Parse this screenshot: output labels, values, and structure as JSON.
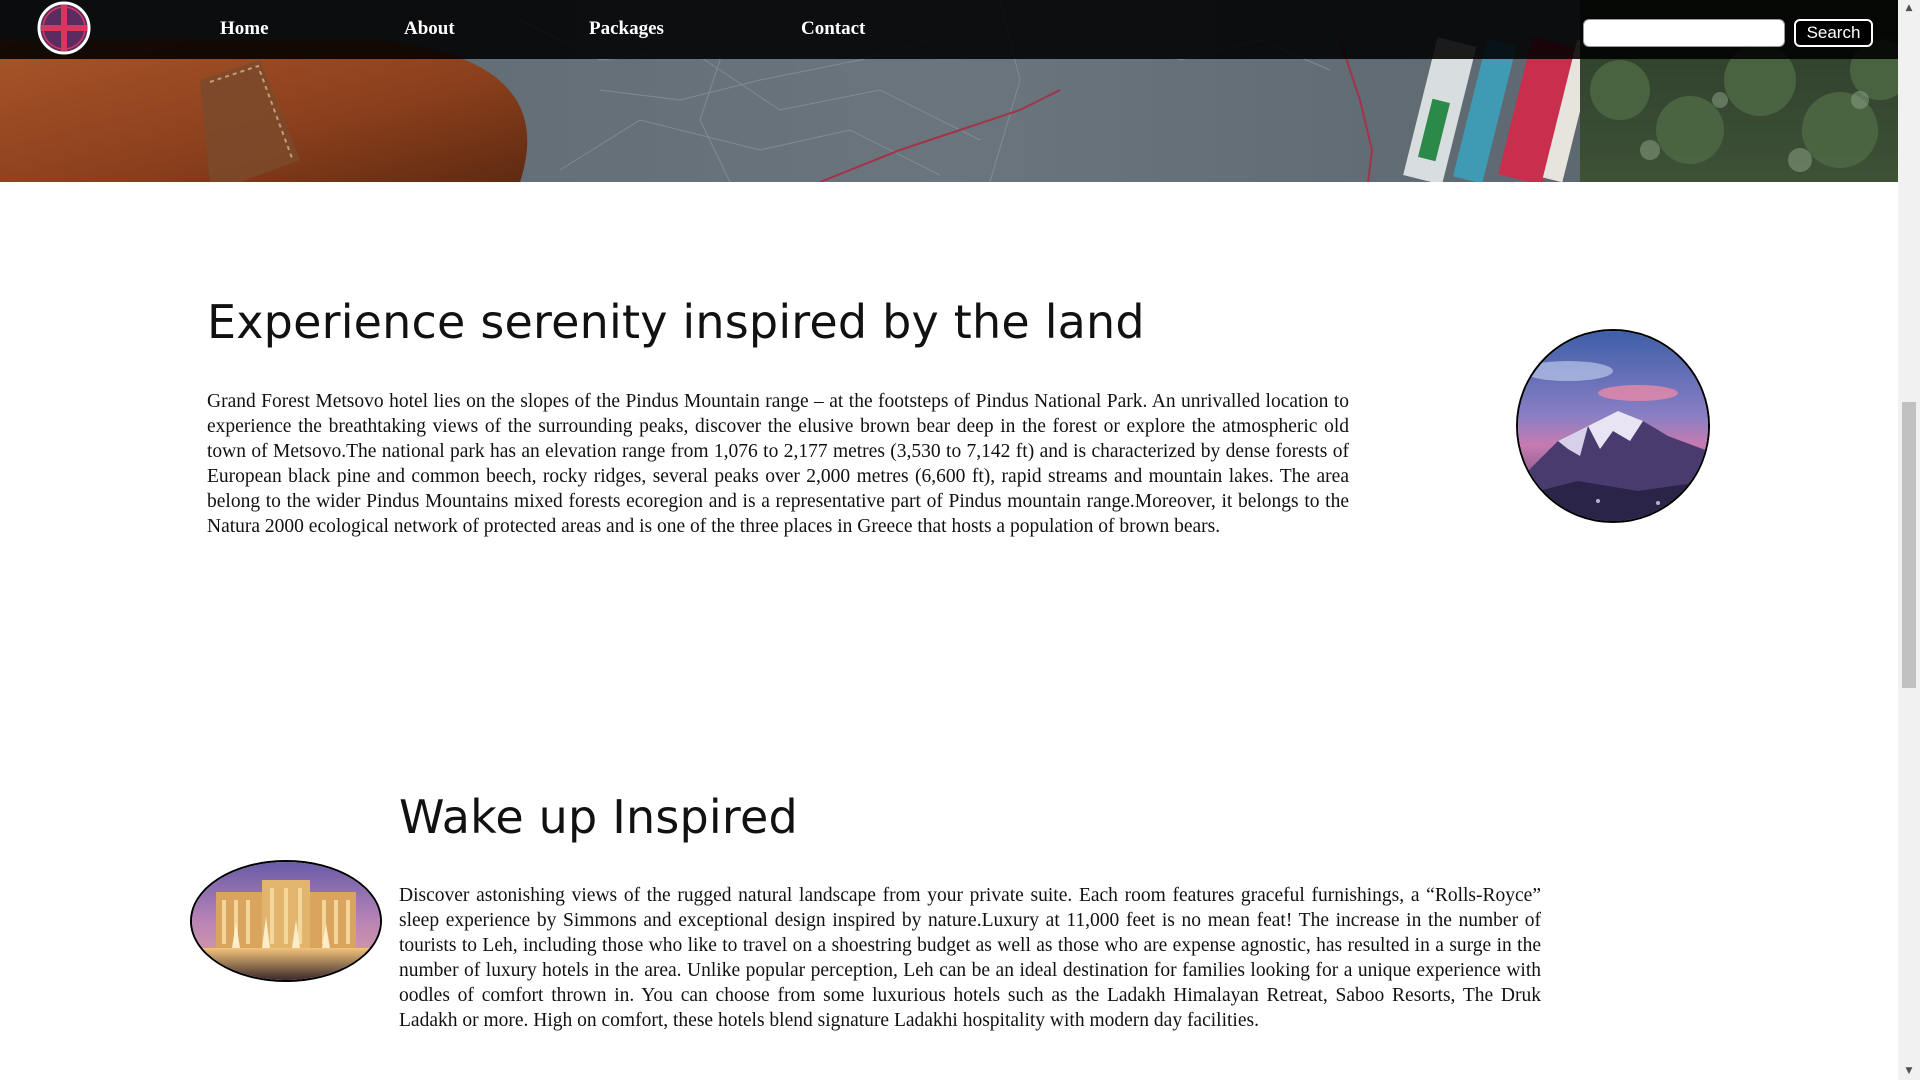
{
  "nav": {
    "logo_icon": "globe-cross-logo-icon",
    "links": [
      {
        "label": "Home"
      },
      {
        "label": "About"
      },
      {
        "label": "Packages"
      },
      {
        "label": "Contact"
      }
    ],
    "search": {
      "value": "",
      "placeholder": "",
      "button_label": "Search"
    }
  },
  "hero": {
    "image": "travel-map-bag-banner"
  },
  "section1": {
    "heading": "Experience serenity inspired by the land",
    "paragraph": "Grand Forest Metsovo hotel lies on the slopes of the Pindus Mountain range – at the footsteps of Pindus National Park. An unrivalled location to experience the breathtaking views of the surrounding peaks, discover the elusive brown bear deep in the forest or explore the atmospheric old town of Metsovo.The national park has an elevation range from 1,076 to 2,177 metres (3,530 to 7,142 ft) and is characterized by dense forests of European black pine and common beech, rocky ridges, several peaks over 2,000 metres (6,600 ft), rapid streams and mountain lakes. The area belong to the wider Pindus Mountains mixed forests ecoregion and is a representative part of Pindus mountain range.Moreover, it belongs to the Natura 2000 ecological network of protected areas and is one of the three places in Greece that hosts a population of brown bears.",
    "image": "snowy-mountain-sunset-photo"
  },
  "section2": {
    "heading": "Wake up Inspired",
    "paragraph": "Discover astonishing views of the rugged natural landscape from your private suite. Each room features graceful furnishings, a “Rolls-Royce” sleep experience by Simmons and exceptional design inspired by nature.Luxury at 11,000 feet is no mean feat! The increase in the number of tourists to Leh, including those who like to travel on a shoestring budget as well as those who are expense agnostic, has resulted in a surge in the number of luxury hotels in the area. Unlike popular perception, Leh can be an ideal destination for families looking for a unique experience with oodles of comfort thrown in. You can choose from some luxurious hotels such as the Ladakh Himalayan Retreat, Saboo Resorts, The Druk Ladakh or more. High on comfort, these hotels blend signature Ladakhi hospitality with modern day facilities.",
    "image": "luxury-hotel-fountain-photo"
  },
  "scrollbar": {
    "up_icon": "scroll-up-arrow-icon",
    "down_icon": "scroll-down-arrow-icon"
  },
  "colors": {
    "navbar_bg": "#000000",
    "nav_text": "#ffffff",
    "logo_accent": "#d9365e",
    "logo_bg": "#5b2c62",
    "page_bg": "#ffffff",
    "text": "#111111"
  }
}
